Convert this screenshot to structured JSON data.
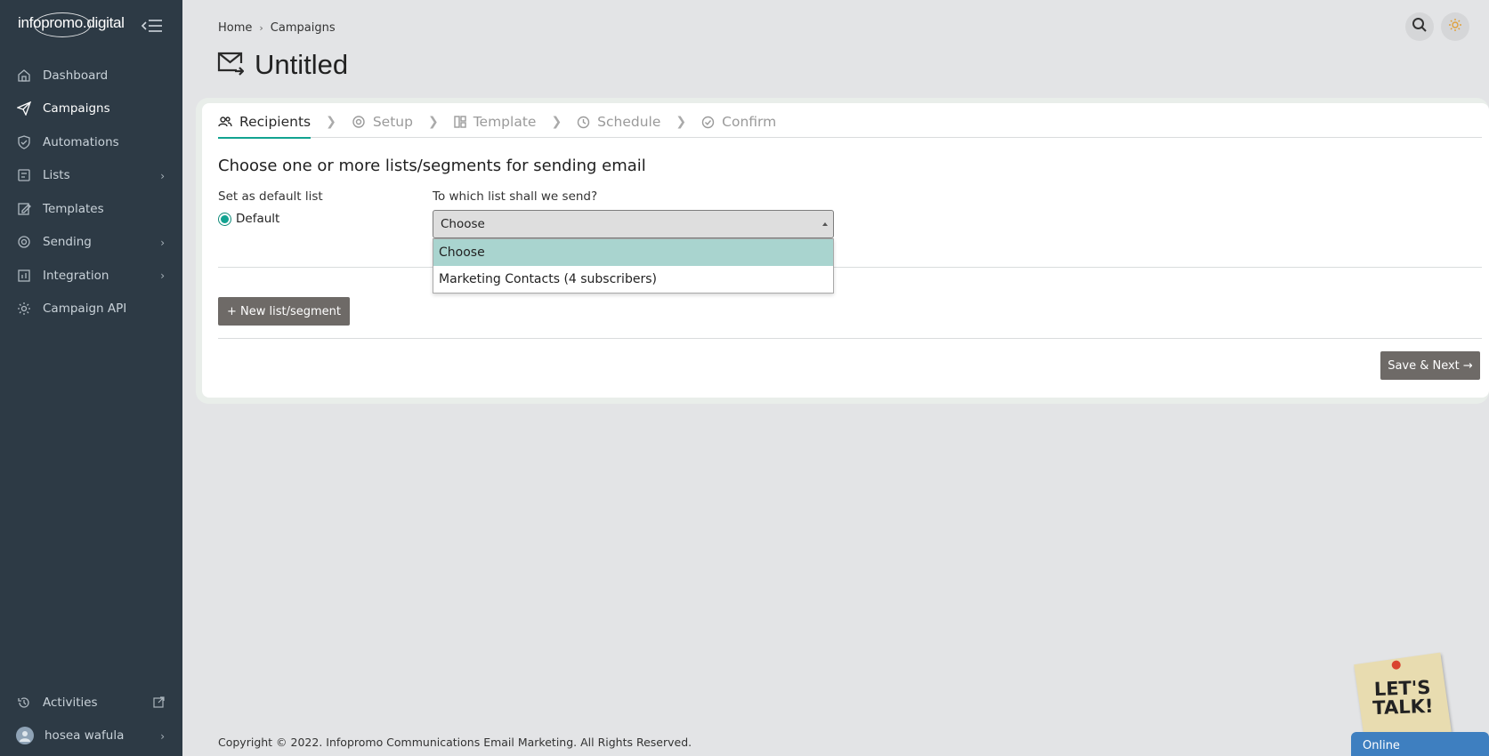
{
  "brand": {
    "logo_text": "infopromo.digital"
  },
  "sidebar": {
    "items": [
      {
        "label": "Dashboard",
        "icon": "home-icon"
      },
      {
        "label": "Campaigns",
        "icon": "paper-plane-icon",
        "active": true
      },
      {
        "label": "Automations",
        "icon": "shield-check-icon"
      },
      {
        "label": "Lists",
        "icon": "list-icon",
        "has_children": true
      },
      {
        "label": "Templates",
        "icon": "edit-icon"
      },
      {
        "label": "Sending",
        "icon": "sending-icon",
        "has_children": true
      },
      {
        "label": "Integration",
        "icon": "integration-icon",
        "has_children": true
      },
      {
        "label": "Campaign API",
        "icon": "gear-icon"
      }
    ],
    "bottom": {
      "activities_label": "Activities",
      "user_name": "hosea wafula"
    }
  },
  "breadcrumb": {
    "home": "Home",
    "current": "Campaigns"
  },
  "page": {
    "title": "Untitled"
  },
  "steps": [
    {
      "label": "Recipients",
      "icon": "users-icon",
      "active": true
    },
    {
      "label": "Setup",
      "icon": "gear-icon"
    },
    {
      "label": "Template",
      "icon": "layout-icon"
    },
    {
      "label": "Schedule",
      "icon": "clock-icon"
    },
    {
      "label": "Confirm",
      "icon": "check-circle-icon"
    }
  ],
  "form": {
    "section_title": "Choose one or more lists/segments for sending email",
    "default_list_label": "Set as default list",
    "default_radio_label": "Default",
    "which_list_label": "To which list shall we send?",
    "select_value": "Choose",
    "options": [
      "Choose",
      "Marketing Contacts (4 subscribers)"
    ],
    "new_list_button": "+ New list/segment",
    "save_next_button": "Save & Next →"
  },
  "footer": {
    "copyright": "Copyright © 2022. Infopromo Communications Email Marketing. All Rights Reserved."
  },
  "chat": {
    "sticker_text": "LET'S TALK!",
    "status": "Online"
  },
  "colors": {
    "sidebar_bg": "#2d3a45",
    "accent": "#12a391",
    "button_bg": "#6e6a67",
    "chat_tab": "#3e7fc0"
  }
}
